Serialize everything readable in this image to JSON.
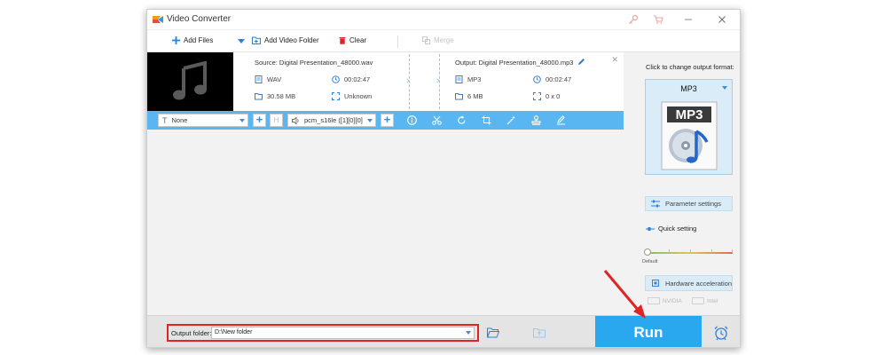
{
  "window": {
    "title": "Video Converter"
  },
  "toolbar": {
    "add_files": "Add Files",
    "add_video_folder": "Add Video Folder",
    "clear": "Clear",
    "merge": "Merge"
  },
  "file": {
    "source_title": "Source: Digital Presentation_48000.wav",
    "source_format": "WAV",
    "source_duration": "00:02:47",
    "source_size": "30.58 MB",
    "source_resolution": "Unknown",
    "output_title": "Output: Digital Presentation_48000.mp3",
    "output_format": "MP3",
    "output_duration": "00:02:47",
    "output_size": "6 MB",
    "output_resolution": "0 x 0"
  },
  "edit_bar": {
    "subtitle_value": "None",
    "audio_track_value": "pcm_s16le ([1][0][0]"
  },
  "right_panel": {
    "change_format_label": "Click to change output format:",
    "format_name": "MP3",
    "format_icon_text": "MP3",
    "parameter_settings": "Parameter settings",
    "quick_setting": "Quick setting",
    "slider_default": "Default",
    "hardware_acceleration": "Hardware acceleration",
    "nvidia": "NVIDIA",
    "intel": "Intel"
  },
  "bottom": {
    "output_folder_label": "Output folder:",
    "output_folder_value": "D:\\New folder",
    "run": "Run"
  },
  "colors": {
    "accent": "#29a8f0",
    "edit_bar": "#5ab6f0",
    "highlight_red": "#e02424",
    "clear_icon": "#e02424"
  }
}
